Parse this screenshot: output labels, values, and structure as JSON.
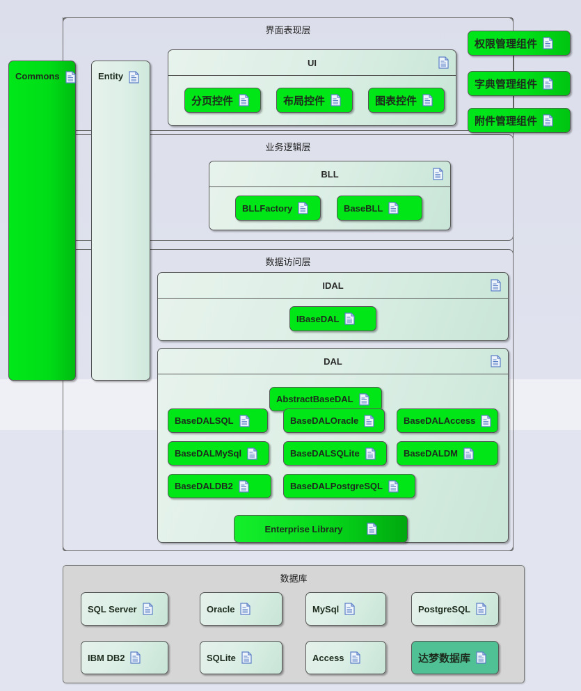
{
  "diagram": {
    "title": "Architecture Layer Diagram",
    "icon": "document-icon",
    "colors": {
      "green": "#00e617",
      "pale_green": "#dcefe6",
      "teal": "#4fc195",
      "background": "#e0e3ee",
      "db_zone": "#d6d6d6",
      "border": "#555555"
    }
  },
  "side_modules": [
    {
      "label": "Commons",
      "icon": "document-icon"
    },
    {
      "label": "Entity",
      "icon": "document-icon"
    }
  ],
  "layers": [
    {
      "name": "presentation",
      "title": "界面表现层"
    },
    {
      "name": "business",
      "title": "业务逻辑层"
    },
    {
      "name": "data_access",
      "title": "数据访问层"
    }
  ],
  "presentation": {
    "package": {
      "label": "UI",
      "icon": "document-icon"
    },
    "items": [
      {
        "label": "分页控件",
        "icon": "document-icon"
      },
      {
        "label": "布局控件",
        "icon": "document-icon"
      },
      {
        "label": "图表控件",
        "icon": "document-icon"
      }
    ]
  },
  "right_components": [
    {
      "label": "权限管理组件",
      "icon": "document-icon"
    },
    {
      "label": "字典管理组件",
      "icon": "document-icon"
    },
    {
      "label": "附件管理组件",
      "icon": "document-icon"
    }
  ],
  "business": {
    "package": {
      "label": "BLL",
      "icon": "document-icon"
    },
    "items": [
      {
        "label": "BLLFactory",
        "icon": "document-icon"
      },
      {
        "label": "BaseBLL",
        "icon": "document-icon"
      }
    ]
  },
  "data_access": {
    "idal": {
      "package": {
        "label": "IDAL",
        "icon": "document-icon"
      },
      "items": [
        {
          "label": "IBaseDAL",
          "icon": "document-icon"
        }
      ]
    },
    "dal": {
      "package": {
        "label": "DAL",
        "icon": "document-icon"
      },
      "items": [
        {
          "label": "AbstractBaseDAL",
          "icon": "document-icon"
        },
        {
          "label": "BaseDALSQL",
          "icon": "document-icon"
        },
        {
          "label": "BaseDALOracle",
          "icon": "document-icon"
        },
        {
          "label": "BaseDALAccess",
          "icon": "document-icon"
        },
        {
          "label": "BaseDALMySql",
          "icon": "document-icon"
        },
        {
          "label": "BaseDALSQLite",
          "icon": "document-icon"
        },
        {
          "label": "BaseDALDM",
          "icon": "document-icon"
        },
        {
          "label": "BaseDALDB2",
          "icon": "document-icon"
        },
        {
          "label": "BaseDALPostgreSQL",
          "icon": "document-icon"
        },
        {
          "label": "Enterprise Library",
          "icon": "document-icon"
        }
      ]
    }
  },
  "database": {
    "title": "数据库",
    "items": [
      {
        "label": "SQL Server",
        "icon": "document-icon",
        "highlight": false
      },
      {
        "label": "Oracle",
        "icon": "document-icon",
        "highlight": false
      },
      {
        "label": "MySql",
        "icon": "document-icon",
        "highlight": false
      },
      {
        "label": "PostgreSQL",
        "icon": "document-icon",
        "highlight": false
      },
      {
        "label": "IBM DB2",
        "icon": "document-icon",
        "highlight": false
      },
      {
        "label": "SQLite",
        "icon": "document-icon",
        "highlight": false
      },
      {
        "label": "Access",
        "icon": "document-icon",
        "highlight": false
      },
      {
        "label": "达梦数据库",
        "icon": "document-icon",
        "highlight": true
      }
    ]
  }
}
